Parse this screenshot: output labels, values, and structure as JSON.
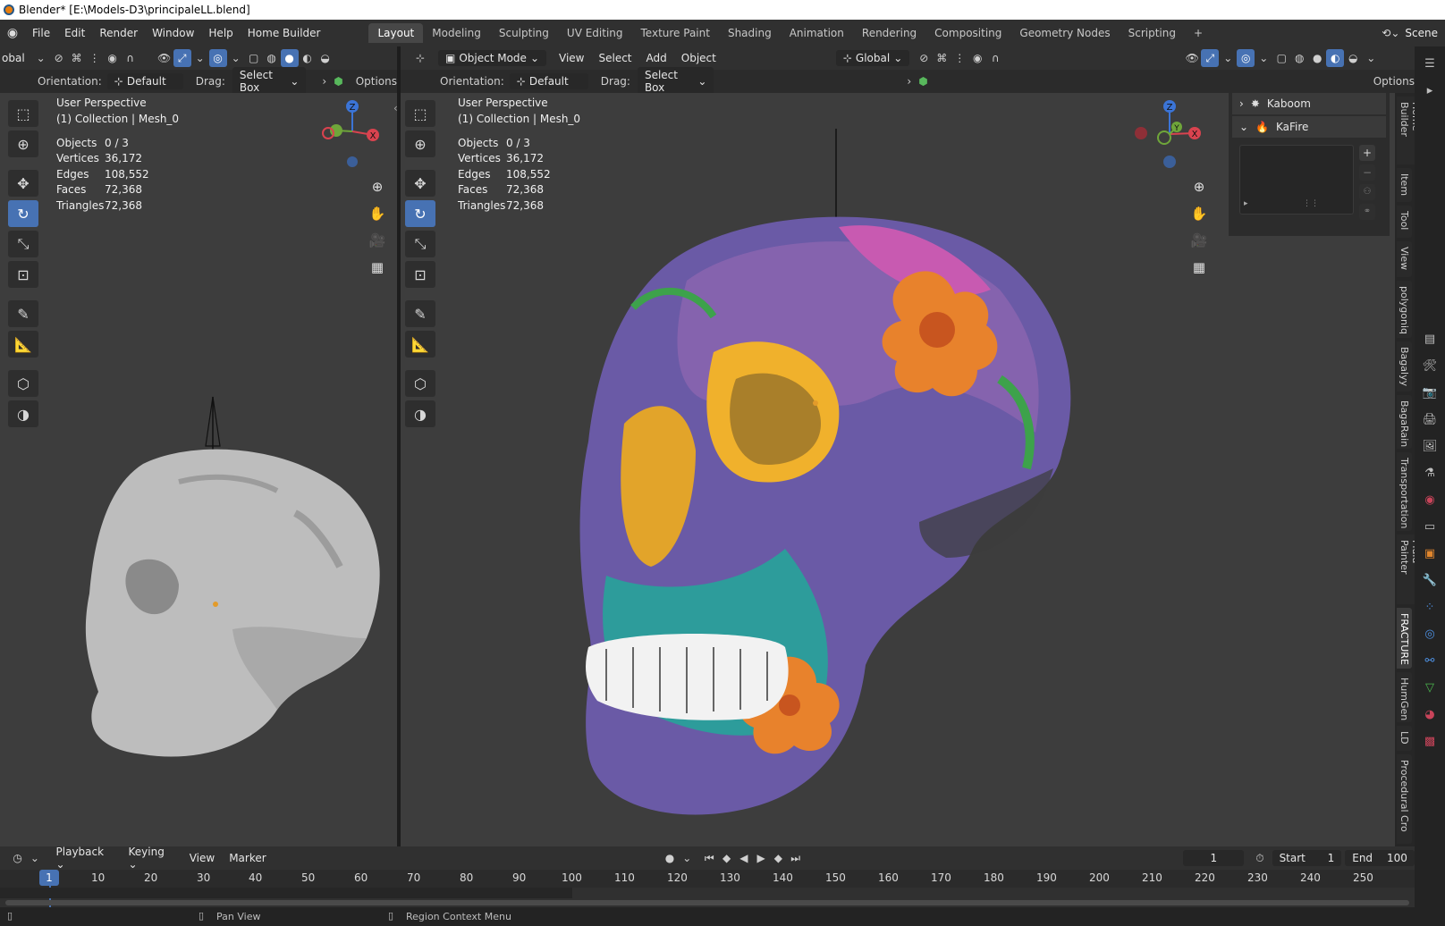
{
  "window_title": "Blender* [E:\\Models-D3\\principaleLL.blend]",
  "menu": [
    "File",
    "Edit",
    "Render",
    "Window",
    "Help",
    "Home Builder"
  ],
  "workspaces": [
    {
      "label": "Layout",
      "active": true
    },
    {
      "label": "Modeling"
    },
    {
      "label": "Sculpting"
    },
    {
      "label": "UV Editing"
    },
    {
      "label": "Texture Paint"
    },
    {
      "label": "Shading"
    },
    {
      "label": "Animation"
    },
    {
      "label": "Rendering"
    },
    {
      "label": "Compositing"
    },
    {
      "label": "Geometry Nodes"
    },
    {
      "label": "Scripting"
    },
    {
      "label": "+"
    }
  ],
  "scene": "Scene",
  "left_view": {
    "transform_orientation": "obal",
    "orientation_label": "Orientation:",
    "orientation_value": "Default",
    "drag_label": "Drag:",
    "drag_value": "Select Box",
    "options": "Options",
    "perspective": "User Perspective",
    "collection": "(1) Collection | Mesh_0",
    "stats": [
      {
        "k": "Objects",
        "v": "0 / 3"
      },
      {
        "k": "Vertices",
        "v": "36,172"
      },
      {
        "k": "Edges",
        "v": "108,552"
      },
      {
        "k": "Faces",
        "v": "72,368"
      },
      {
        "k": "Triangles",
        "v": "72,368"
      }
    ]
  },
  "right_view": {
    "mode": "Object Mode",
    "menus": [
      "View",
      "Select",
      "Add",
      "Object"
    ],
    "transform_orientation": "Global",
    "orientation_label": "Orientation:",
    "orientation_value": "Default",
    "drag_label": "Drag:",
    "drag_value": "Select Box",
    "options": "Options",
    "perspective": "User Perspective",
    "collection": "(1) Collection | Mesh_0",
    "stats": [
      {
        "k": "Objects",
        "v": "0 / 3"
      },
      {
        "k": "Vertices",
        "v": "36,172"
      },
      {
        "k": "Edges",
        "v": "108,552"
      },
      {
        "k": "Faces",
        "v": "72,368"
      },
      {
        "k": "Triangles",
        "v": "72,368"
      }
    ]
  },
  "gizmo": {
    "z": "Z",
    "x": "X",
    "y": "Y"
  },
  "npanel": {
    "addons": [
      "Kaboom",
      "KaFire"
    ],
    "tabs": [
      "Home Builder",
      "Item",
      "Tool",
      "View",
      "polygoniq",
      "Bagalyy",
      "BagaRain",
      "Transportation",
      "Fluid Painter",
      "FRACTURE",
      "HumGen",
      "LD",
      "Procedural Cro"
    ],
    "active_tab": "FRACTURE"
  },
  "timeline": {
    "menus": [
      "Playback",
      "Keying",
      "View",
      "Marker"
    ],
    "current_frame": "1",
    "start_label": "Start",
    "start": "1",
    "end_label": "End",
    "end": "100",
    "ticks": [
      "1",
      "10",
      "20",
      "30",
      "40",
      "50",
      "60",
      "70",
      "80",
      "90",
      "100",
      "110",
      "120",
      "130",
      "140",
      "150",
      "160",
      "170",
      "180",
      "190",
      "200",
      "210",
      "220",
      "230",
      "240",
      "250"
    ]
  },
  "status": {
    "pan": "Pan View",
    "context": "Region Context Menu"
  },
  "colors": {
    "accent": "#4772b3",
    "header": "#303030",
    "viewport": "#3d3d3d"
  }
}
